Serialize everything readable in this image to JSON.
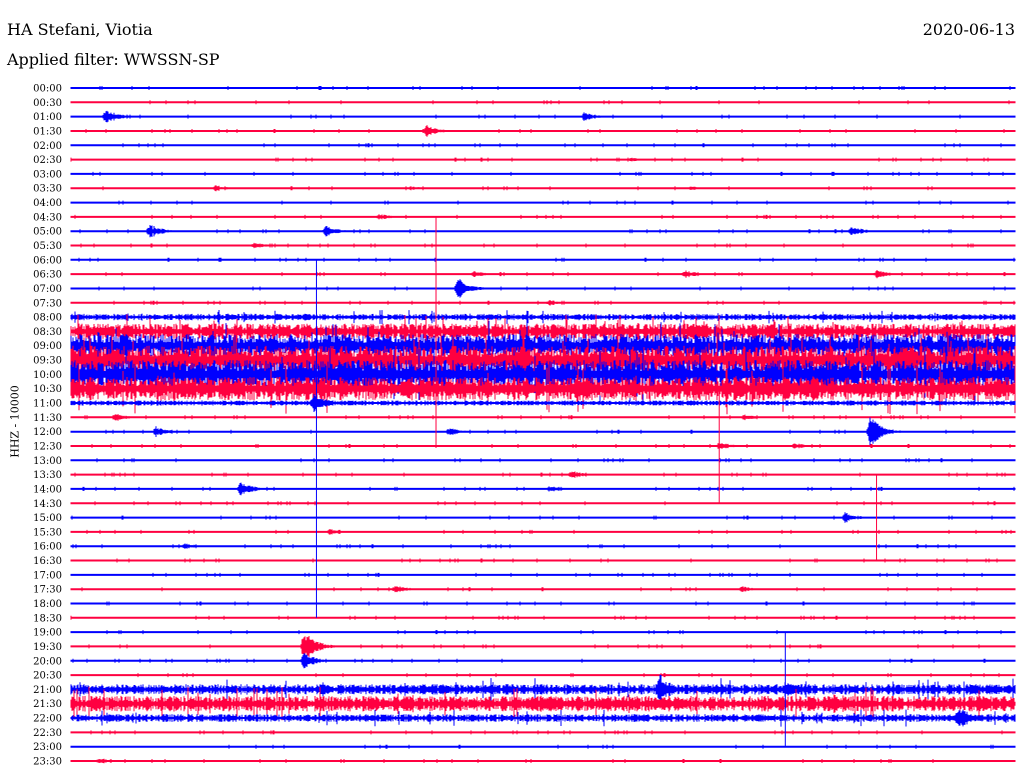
{
  "header": {
    "station": "HA Stefani, Viotia",
    "date": "2020-06-13",
    "filter": "Applied filter: WWSSN-SP"
  },
  "chart_data": {
    "type": "line",
    "title": "HA Stefani, Viotia",
    "ylabel": "HHZ - 10000",
    "xlabel": "",
    "row_minutes": 30,
    "colors": [
      "#0000ff",
      "#ff0040"
    ],
    "rows": [
      "00:00",
      "00:30",
      "01:00",
      "01:30",
      "02:00",
      "02:30",
      "03:00",
      "03:30",
      "04:00",
      "04:30",
      "05:00",
      "05:30",
      "06:00",
      "06:30",
      "07:00",
      "07:30",
      "08:00",
      "08:30",
      "09:00",
      "09:30",
      "10:00",
      "10:30",
      "11:00",
      "11:30",
      "12:00",
      "12:30",
      "13:00",
      "13:30",
      "14:00",
      "14:30",
      "15:00",
      "15:30",
      "16:00",
      "16:30",
      "17:00",
      "17:30",
      "18:00",
      "18:30",
      "19:00",
      "19:30",
      "20:00",
      "20:30",
      "21:00",
      "21:30",
      "22:00",
      "22:30",
      "23:00",
      "23:30"
    ],
    "noise": {
      "16": 2.5,
      "17": 6,
      "18": 9,
      "19": 11,
      "20": 11,
      "21": 9,
      "22": 2,
      "42": 4,
      "43": 6,
      "44": 3
    },
    "events": [
      {
        "row": 2,
        "minute": 1.1,
        "amp": 7
      },
      {
        "row": 2,
        "minute": 16.3,
        "amp": 4
      },
      {
        "row": 3,
        "minute": 11.3,
        "amp": 6
      },
      {
        "row": 5,
        "minute": 17.8,
        "amp": 2
      },
      {
        "row": 7,
        "minute": 4.6,
        "amp": 3
      },
      {
        "row": 7,
        "minute": 10.8,
        "amp": 2
      },
      {
        "row": 7,
        "minute": 19.7,
        "amp": 2
      },
      {
        "row": 9,
        "minute": 9.8,
        "amp": 3
      },
      {
        "row": 10,
        "minute": 2.5,
        "amp": 7
      },
      {
        "row": 10,
        "minute": 8.1,
        "amp": 5
      },
      {
        "row": 10,
        "minute": 24.8,
        "amp": 5
      },
      {
        "row": 11,
        "minute": 5.8,
        "amp": 3
      },
      {
        "row": 13,
        "minute": 12.8,
        "amp": 3
      },
      {
        "row": 13,
        "minute": 19.5,
        "amp": 4
      },
      {
        "row": 13,
        "minute": 25.6,
        "amp": 4
      },
      {
        "row": 14,
        "minute": 12.3,
        "amp": 10
      },
      {
        "row": 15,
        "minute": 15.2,
        "amp": 3
      },
      {
        "row": 22,
        "minute": 7.7,
        "amp": 10
      },
      {
        "row": 23,
        "minute": 1.4,
        "amp": 4
      },
      {
        "row": 23,
        "minute": 21.4,
        "amp": 3
      },
      {
        "row": 24,
        "minute": 2.7,
        "amp": 5
      },
      {
        "row": 24,
        "minute": 12.0,
        "amp": 4
      },
      {
        "row": 24,
        "minute": 25.4,
        "amp": 14
      },
      {
        "row": 25,
        "minute": 20.6,
        "amp": 4
      },
      {
        "row": 25,
        "minute": 23.0,
        "amp": 3
      },
      {
        "row": 27,
        "minute": 15.9,
        "amp": 4
      },
      {
        "row": 28,
        "minute": 5.4,
        "amp": 7
      },
      {
        "row": 28,
        "minute": 15.2,
        "amp": 3
      },
      {
        "row": 30,
        "minute": 24.6,
        "amp": 5
      },
      {
        "row": 31,
        "minute": 8.2,
        "amp": 3
      },
      {
        "row": 32,
        "minute": 3.6,
        "amp": 3
      },
      {
        "row": 35,
        "minute": 10.3,
        "amp": 4
      },
      {
        "row": 35,
        "minute": 21.3,
        "amp": 3
      },
      {
        "row": 39,
        "minute": 7.4,
        "amp": 15
      },
      {
        "row": 40,
        "minute": 7.4,
        "amp": 8
      },
      {
        "row": 42,
        "minute": 18.7,
        "amp": 15
      },
      {
        "row": 42,
        "minute": 22.7,
        "amp": 8
      },
      {
        "row": 42,
        "minute": 28.6,
        "amp": 6
      },
      {
        "row": 44,
        "minute": 28.2,
        "amp": 12
      },
      {
        "row": 47,
        "minute": 0.9,
        "amp": 3
      }
    ],
    "spikes": [
      {
        "minute": 11.6,
        "from_row": 9,
        "to_row": 25
      },
      {
        "minute": 7.8,
        "from_row": 12,
        "to_row": 37
      },
      {
        "minute": 25.6,
        "from_row": 27,
        "to_row": 33
      },
      {
        "minute": 22.7,
        "from_row": 38,
        "to_row": 46
      },
      {
        "minute": 20.6,
        "from_row": 21,
        "to_row": 29
      }
    ]
  }
}
